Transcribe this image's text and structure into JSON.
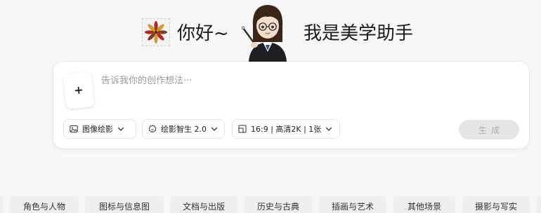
{
  "header": {
    "greeting": "你好~",
    "assistant_role": "我是美学助手"
  },
  "composer": {
    "upload_label": "+",
    "prompt_placeholder": "告诉我你的创作想法···",
    "prompt_value": "",
    "mode_chip": {
      "label": "图像绘影",
      "icon": "image-icon"
    },
    "model_chip": {
      "label": "绘影智生 2.0",
      "icon": "model-icon"
    },
    "ratio_chip": {
      "label": "16:9 | 高清2K | 1张",
      "icon": "aspect-ratio-icon"
    },
    "generate_label": "生成"
  },
  "categories": [
    "角色与人物",
    "图标与信息图",
    "文档与出版",
    "历史与古典",
    "插画与艺术",
    "其他场景",
    "摄影与写实"
  ],
  "colors": {
    "background": "#f7f7f8",
    "card": "#ffffff",
    "generate_disabled_bg": "#e6e6e8",
    "generate_disabled_text": "#b0b0b4",
    "category_bg": "#efeff1"
  }
}
